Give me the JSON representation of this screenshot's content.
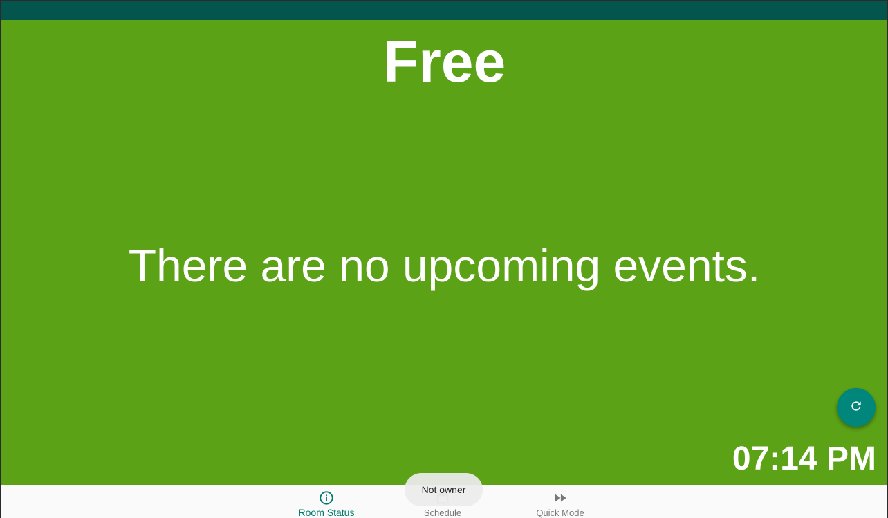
{
  "room": {
    "status_label": "Free",
    "empty_message": "There are no upcoming events."
  },
  "clock": {
    "time": "07:14 PM"
  },
  "actions": {
    "refresh_icon": "refresh-icon"
  },
  "bottom_nav": {
    "active_index": 0,
    "items": [
      {
        "label": "Room Status",
        "icon": "info-icon"
      },
      {
        "label": "Schedule",
        "icon": "calendar-icon"
      },
      {
        "label": "Quick Mode",
        "icon": "fast-forward-icon"
      }
    ]
  },
  "toast": {
    "message": "Not owner"
  },
  "colors": {
    "status_bar": "#03554d",
    "background_free": "#5ca216",
    "accent": "#00867a",
    "nav_active": "#00796b",
    "nav_inactive": "#777777"
  }
}
